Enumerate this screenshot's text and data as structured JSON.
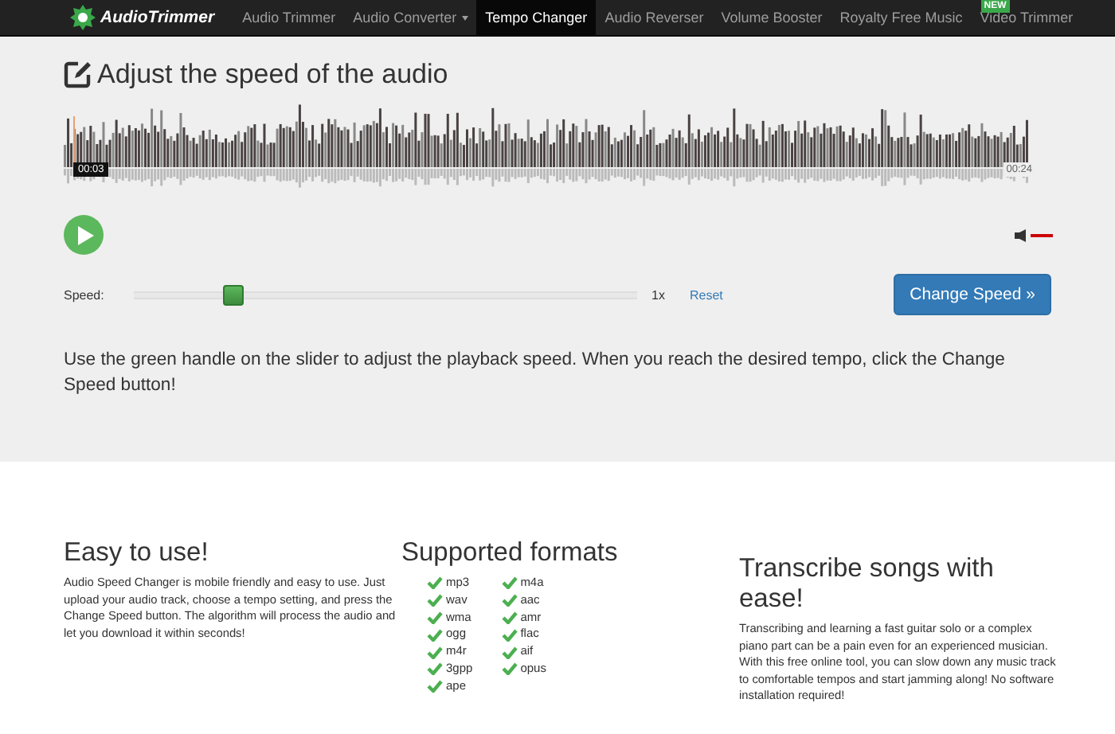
{
  "navbar": {
    "logo": "AudioTrimmer",
    "items": [
      {
        "label": "Audio Trimmer",
        "selected": false,
        "dropdown": false
      },
      {
        "label": "Audio Converter",
        "selected": false,
        "dropdown": true
      },
      {
        "label": "Tempo Changer",
        "selected": true,
        "dropdown": false
      },
      {
        "label": "Audio Reverser",
        "selected": false,
        "dropdown": false
      },
      {
        "label": "Volume Booster",
        "selected": false,
        "dropdown": false
      },
      {
        "label": "Royalty Free Music",
        "selected": false,
        "dropdown": false
      },
      {
        "label": "Video Trimmer",
        "selected": false,
        "dropdown": false,
        "badge": "NEW"
      }
    ]
  },
  "title": "Adjust the speed of the audio",
  "player": {
    "current_time": "00:03",
    "total_time": "00:24",
    "progress": {
      "level": 0.01
    },
    "volume": {
      "level": 1
    }
  },
  "speed": {
    "label": "Speed:",
    "slider": {
      "level": 0.2
    },
    "value": "1x",
    "reset": "Reset",
    "button": "Change Speed »"
  },
  "instructions": "Use the green handle on the slider to adjust the playback speed. When you reach the desired tempo, click the Change Speed button!",
  "features": [
    {
      "kind": "text",
      "heading": "Easy to use!",
      "body": "Audio Speed Changer is mobile friendly and easy to use. Just upload your audio track, choose a tempo setting, and press the Change Speed button. The algorithm will process the audio and let you download it within seconds!"
    },
    {
      "kind": "formats",
      "heading": "Supported formats",
      "columns": [
        [
          "mp3",
          "wav",
          "wma",
          "ogg",
          "m4r",
          "3gpp",
          "ape"
        ],
        [
          "m4a",
          "aac",
          "amr",
          "flac",
          "aif",
          "opus"
        ]
      ]
    },
    {
      "kind": "text",
      "heading": "Transcribe songs with ease!",
      "body": "Transcribing and learning a fast guitar solo or a complex piano part can be a pain even for an experienced musician. With this free online tool, you can slow down any music track to comfortable tempos and start jamming along! No software installation required!"
    }
  ]
}
